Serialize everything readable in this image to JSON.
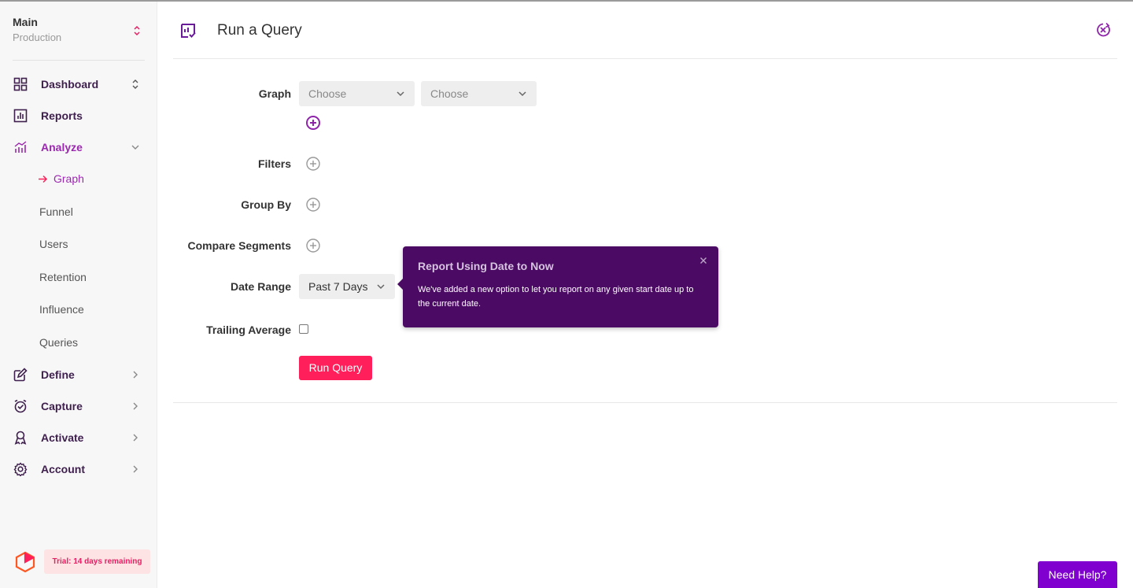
{
  "workspace": {
    "name": "Main",
    "environment": "Production"
  },
  "sidebar": {
    "items": [
      {
        "label": "Dashboard",
        "icon": "grid-icon"
      },
      {
        "label": "Reports",
        "icon": "report-icon"
      },
      {
        "label": "Analyze",
        "icon": "analyze-icon"
      },
      {
        "label": "Define",
        "icon": "define-icon"
      },
      {
        "label": "Capture",
        "icon": "capture-icon"
      },
      {
        "label": "Activate",
        "icon": "activate-icon"
      },
      {
        "label": "Account",
        "icon": "gear-icon"
      }
    ],
    "analyze_sub": [
      "Graph",
      "Funnel",
      "Users",
      "Retention",
      "Influence",
      "Queries"
    ],
    "trial": "Trial: 14 days remaining"
  },
  "header": {
    "title": "Run a Query"
  },
  "form": {
    "graph_label": "Graph",
    "graph_select_1": "Choose",
    "graph_select_2": "Choose",
    "filters_label": "Filters",
    "groupby_label": "Group By",
    "compare_label": "Compare Segments",
    "daterange_label": "Date Range",
    "daterange_value": "Past 7 Days",
    "trailing_label": "Trailing Average",
    "trailing_checked": false,
    "run_button": "Run Query"
  },
  "tooltip": {
    "title": "Report Using Date to Now",
    "body": "We've added a new option to let you report on any given start date up to the current date."
  },
  "help_button": "Need Help?",
  "colors": {
    "brand_purple": "#9c27b0",
    "accent_red": "#ff1f5a",
    "tooltip_bg": "#4b0a63",
    "help_bg": "#8000d0"
  }
}
